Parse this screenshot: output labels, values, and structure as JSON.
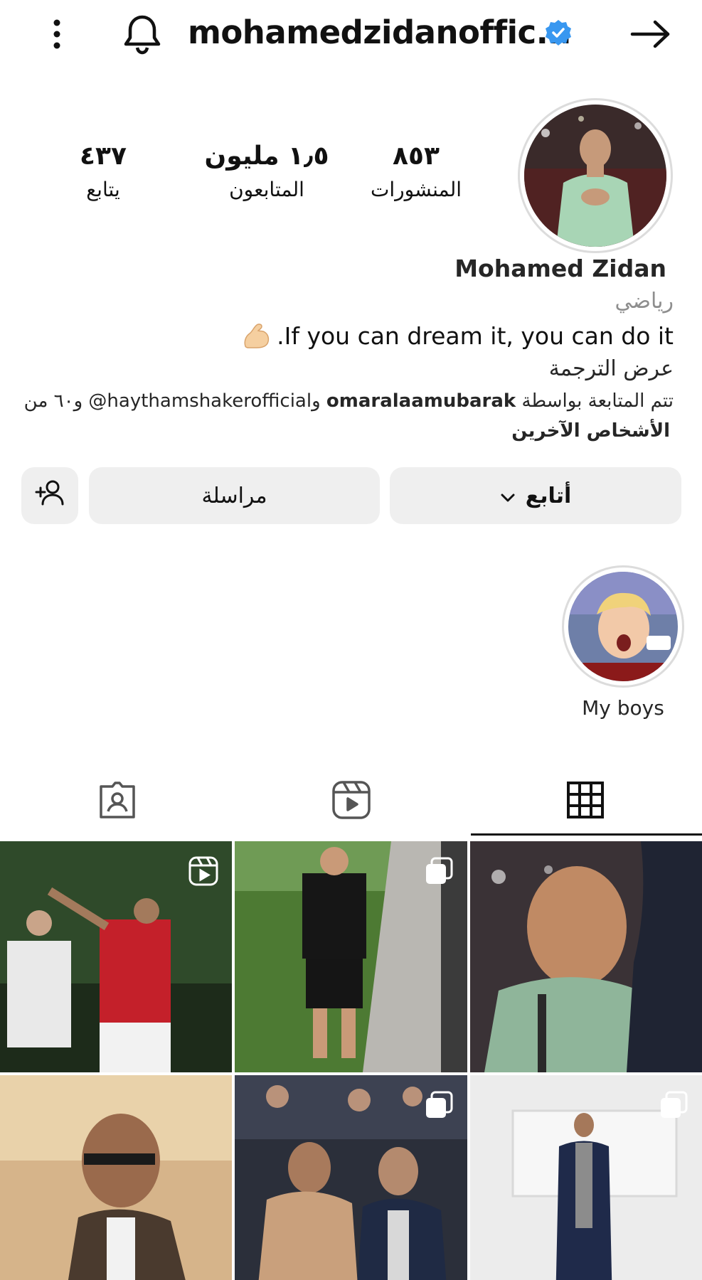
{
  "header": {
    "username": "mohamedzidanoffic...",
    "icons": [
      "more-vertical-icon",
      "bell-icon",
      "verified-badge-icon",
      "arrow-right-icon"
    ]
  },
  "stats": {
    "posts": {
      "value": "٨٥٣",
      "label": "المنشورات"
    },
    "followers": {
      "value": "١٫٥ مليون",
      "label": "المتابعون"
    },
    "following": {
      "value": "٤٣٧",
      "label": "يتابع"
    }
  },
  "profile": {
    "full_name": "Mohamed Zidan",
    "category": "رياضي",
    "bio": ".If you can dream it, you can do it",
    "see_translation": "عرض الترجمة",
    "followed_by_prefix": "تتم المتابعة بواسطة",
    "followed_by_user1": "omaralaamubarak",
    "followed_by_and": "و",
    "followed_by_user2": "haythamshakerofficial@",
    "followed_by_suffix": "و٦٠ من",
    "followed_by_line2": "الأشخاص الآخرين"
  },
  "actions": {
    "follow_label": "أتابع",
    "message_label": "مراسلة"
  },
  "highlights": [
    {
      "label": "My boys"
    }
  ],
  "tabs": [
    "grid-icon",
    "reels-icon",
    "tagged-icon"
  ],
  "colors": {
    "verified": "#3897f0",
    "button_bg": "#efefef",
    "muted_text": "#8e8e8e"
  }
}
